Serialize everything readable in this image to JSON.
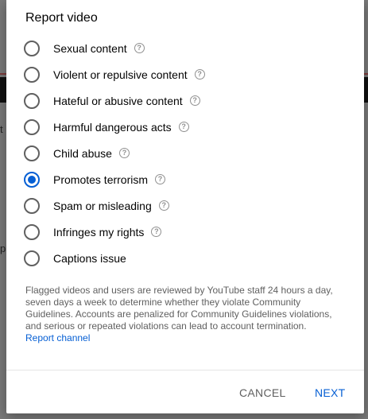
{
  "dialog": {
    "title": "Report video",
    "options": [
      {
        "label": "Sexual content",
        "help": true,
        "selected": false
      },
      {
        "label": "Violent or repulsive content",
        "help": true,
        "selected": false
      },
      {
        "label": "Hateful or abusive content",
        "help": true,
        "selected": false
      },
      {
        "label": "Harmful dangerous acts",
        "help": true,
        "selected": false
      },
      {
        "label": "Child abuse",
        "help": true,
        "selected": false
      },
      {
        "label": "Promotes terrorism",
        "help": true,
        "selected": true
      },
      {
        "label": "Spam or misleading",
        "help": true,
        "selected": false
      },
      {
        "label": "Infringes my rights",
        "help": true,
        "selected": false
      },
      {
        "label": "Captions issue",
        "help": false,
        "selected": false
      }
    ],
    "help_glyph": "?",
    "note": "Flagged videos and users are reviewed by YouTube staff 24 hours a day, seven days a week to determine whether they violate Community Guidelines. Accounts are penalized for Community Guidelines violations, and serious or repeated violations can lead to account termination.",
    "report_channel_link": "Report channel",
    "cancel_label": "CANCEL",
    "next_label": "NEXT"
  },
  "background": {
    "left_glyph_1": "t",
    "left_glyph_2": "p"
  },
  "colors": {
    "accent": "#065fd4",
    "text": "#030303",
    "secondary_text": "#606060"
  }
}
